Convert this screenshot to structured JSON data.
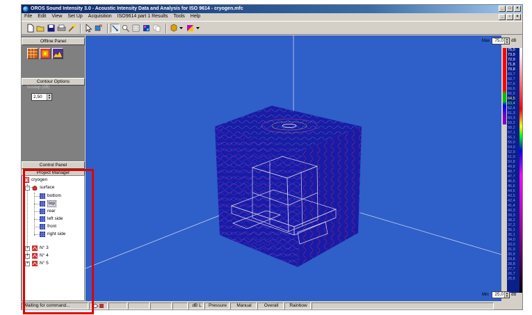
{
  "window": {
    "title": "OROS Sound Intensity 3.0 - Acoustic Intensity Data and Analysis for ISO 9614 - cryogen.mfc",
    "controls": {
      "minimize": "_",
      "maximize": "□",
      "close": "×"
    }
  },
  "menu": {
    "items": [
      "File",
      "Edit",
      "View",
      "Set Up",
      "Acquisition",
      "ISO9614 part 1 Results",
      "Tools",
      "Help"
    ],
    "mdi_controls": {
      "minimize": "_",
      "restore": "▫",
      "close": "×"
    }
  },
  "toolbar": {
    "icons": [
      "new-icon",
      "open-icon",
      "save-icon",
      "print-icon",
      "wand-icon",
      "pointer-icon",
      "rotate-icon",
      "probe-icon",
      "zoom-icon",
      "grid-icon",
      "cube-icon",
      "copy-icon",
      "display-mode-icon",
      "palette-icon"
    ]
  },
  "left_panel": {
    "offline_panel_title": "Offline Panel",
    "contour_options_title": "Contour Options",
    "isostep_label": "Isostep (dB)",
    "isostep_value": "2,50",
    "control_panel_title": "Control Panel",
    "project_manager_title": "Project Manager"
  },
  "tree": {
    "root": "cryogen",
    "surface": "surface",
    "faces": [
      "bottom",
      "top",
      "rear",
      "left side",
      "front",
      "right side"
    ],
    "selected_face": "top",
    "items": [
      "N° 3",
      "N° 4",
      "N° 5"
    ]
  },
  "scale": {
    "max_label": "Max",
    "max_value": "75,0",
    "min_label": "Min",
    "min_value": "25,0",
    "unit": "dB",
    "levels": [
      "75,0",
      "73,9",
      "72,9",
      "71,8",
      "70,8",
      "69,7",
      "68,7",
      "67,6",
      "66,6",
      "65,5",
      "64,5",
      "63,4",
      "62,4",
      "61,3",
      "60,3",
      "59,2",
      "58,2",
      "57,1",
      "56,1",
      "55,0",
      "54,0",
      "52,9",
      "51,9",
      "50,8",
      "49,8",
      "48,7",
      "47,7",
      "46,6",
      "45,6",
      "44,5",
      "43,5",
      "42,4",
      "41,4",
      "40,3",
      "39,3",
      "38,2",
      "37,2",
      "36,1",
      "35,1",
      "34,0",
      "33,0",
      "31,9",
      "30,9",
      "29,8",
      "28,8",
      "27,7",
      "26,7",
      "25,6"
    ]
  },
  "status": {
    "message": "Waiting for command...",
    "weighting": "dB L",
    "quantity": "Pressure",
    "mode": "Manual",
    "band": "Overall",
    "palette": "Rainbow"
  },
  "colors": {
    "viewport_bg": "#2f5fc9",
    "cube_face": "#1a1aa8",
    "highlight_box": "#e00000",
    "title_bar": "#0a246a"
  }
}
